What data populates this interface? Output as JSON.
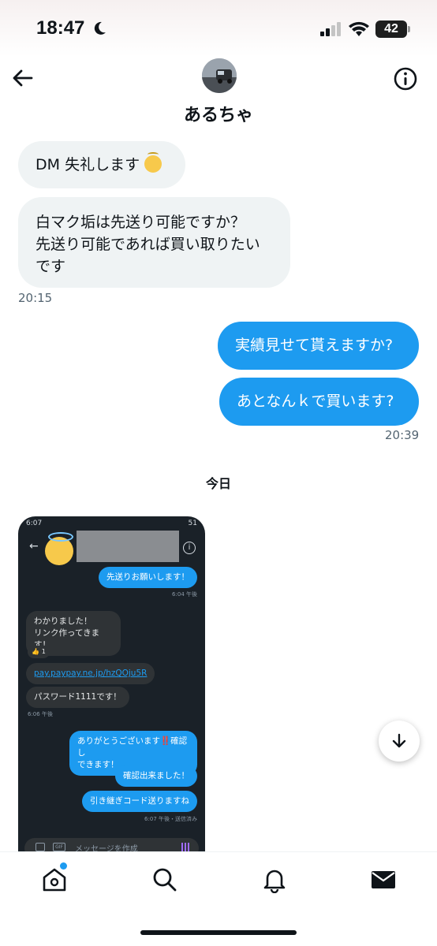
{
  "status_bar": {
    "time": "18:47",
    "battery": "42"
  },
  "header": {
    "contact_name": "あるちゃ"
  },
  "messages": {
    "m1": "DM 失礼します",
    "m2_line1": "白マク垢は先送り可能ですか？",
    "m2_line2": "先送り可能であれば買い取りたい",
    "m2_line3": "です",
    "ts1": "20:15",
    "m3": "実績見せて貰えますか?",
    "m4": "あとなんｋで買います?",
    "ts2": "20:39"
  },
  "day_separator": "今日",
  "embedded_screenshot": {
    "status_time": "6:07",
    "status_right": "51",
    "b1": "先送りお願いします！",
    "ts1": "6:04 午後",
    "b2_line1": "わかりました！",
    "b2_line2": "リンク作ってきます！",
    "reaction": "1",
    "link": "pay.paypay.ne.jp/hzQOju5R",
    "b3": "パスワード1111です！",
    "ts2": "6:06 午後",
    "b4_line1": "ありがとうございます‼️確認し",
    "b4_line2": "できます！",
    "b5": "確認出来ました！",
    "b6": "引き継ぎコード送りますね",
    "ts3": "6:07 午後・送信済み",
    "composer_placeholder": "メッセージを作成"
  },
  "icons": [
    "back-arrow-icon",
    "info-icon",
    "home-icon",
    "search-icon",
    "bell-icon",
    "mail-icon",
    "arrow-down-icon"
  ],
  "colors": {
    "accent": "#1d9bf0",
    "incoming_bubble": "#eff3f4"
  }
}
